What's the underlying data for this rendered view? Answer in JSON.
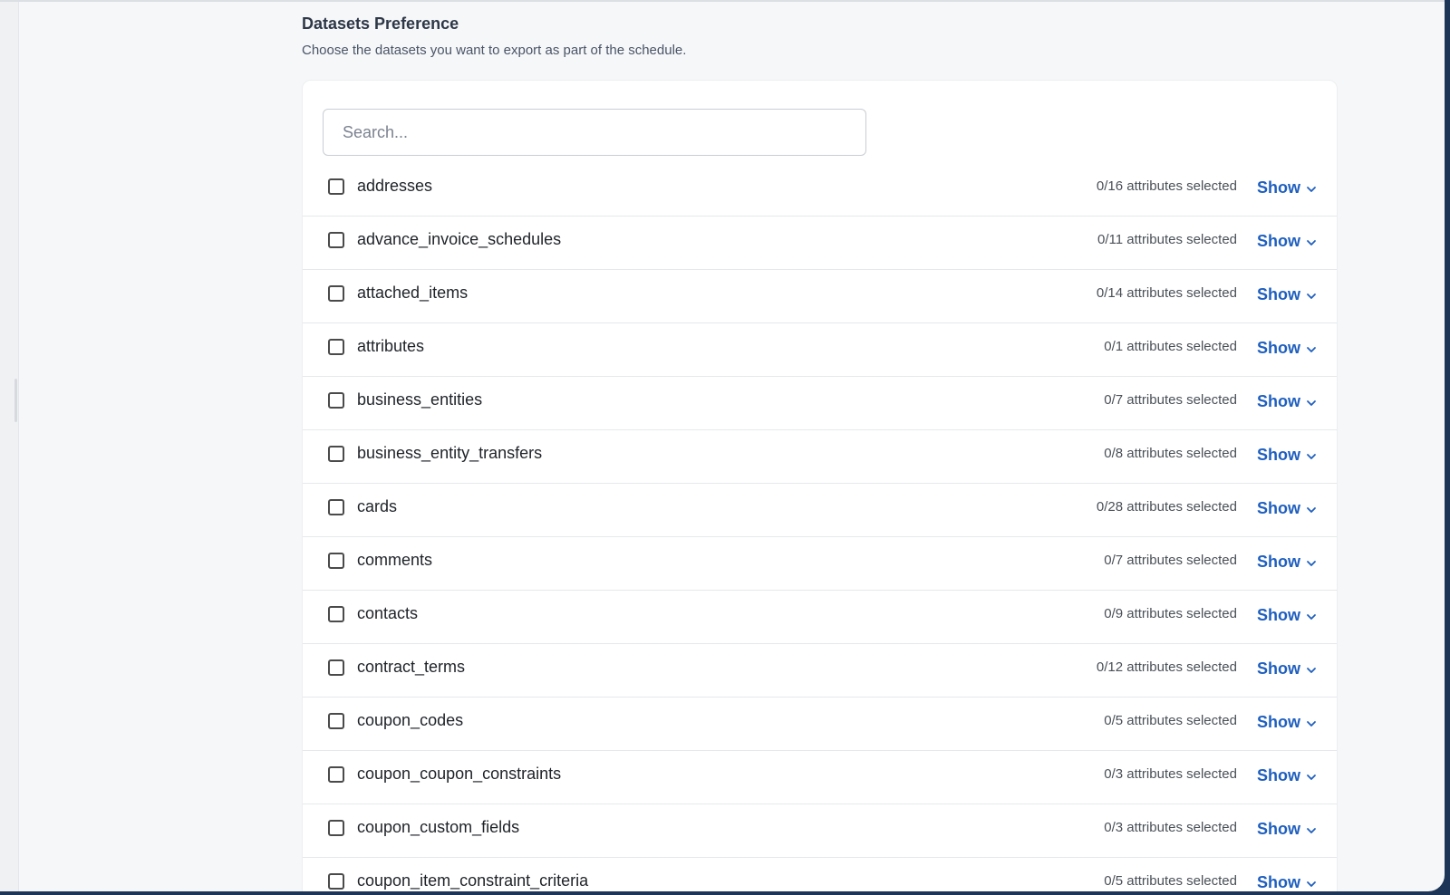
{
  "section": {
    "title": "Datasets Preference",
    "description": "Choose the datasets you want to export as part of the schedule."
  },
  "search": {
    "placeholder": "Search...",
    "value": ""
  },
  "show_label": "Show",
  "icons": {
    "row_toggle": "chevron-down-icon",
    "row_select": "checkbox"
  },
  "colors": {
    "accent": "#1f5fbf",
    "text": "#1f2328",
    "muted": "#4a5057"
  },
  "datasets": [
    {
      "name": "addresses",
      "attributes": "0/16 attributes selected"
    },
    {
      "name": "advance_invoice_schedules",
      "attributes": "0/11 attributes selected"
    },
    {
      "name": "attached_items",
      "attributes": "0/14 attributes selected"
    },
    {
      "name": "attributes",
      "attributes": "0/1 attributes selected"
    },
    {
      "name": "business_entities",
      "attributes": "0/7 attributes selected"
    },
    {
      "name": "business_entity_transfers",
      "attributes": "0/8 attributes selected"
    },
    {
      "name": "cards",
      "attributes": "0/28 attributes selected"
    },
    {
      "name": "comments",
      "attributes": "0/7 attributes selected"
    },
    {
      "name": "contacts",
      "attributes": "0/9 attributes selected"
    },
    {
      "name": "contract_terms",
      "attributes": "0/12 attributes selected"
    },
    {
      "name": "coupon_codes",
      "attributes": "0/5 attributes selected"
    },
    {
      "name": "coupon_coupon_constraints",
      "attributes": "0/3 attributes selected"
    },
    {
      "name": "coupon_custom_fields",
      "attributes": "0/3 attributes selected"
    },
    {
      "name": "coupon_item_constraint_criteria",
      "attributes": "0/5 attributes selected"
    }
  ]
}
